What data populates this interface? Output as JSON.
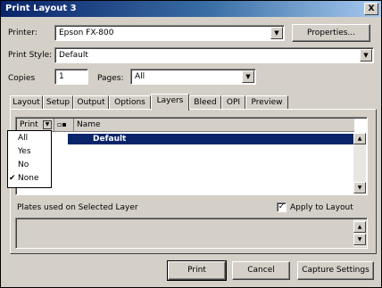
{
  "window": {
    "title": "Print Layout 3",
    "close_label": "X"
  },
  "printer": {
    "label": "Printer:",
    "value": "Epson FX-800",
    "properties_label": "Properties..."
  },
  "print_style": {
    "label": "Print Style:",
    "value": "Default"
  },
  "copies": {
    "label": "Copies",
    "value": "1"
  },
  "pages": {
    "label": "Pages:",
    "value": "All"
  },
  "tabs": [
    "Layout",
    "Setup",
    "Output",
    "Options",
    "Layers",
    "Bleed",
    "OPI",
    "Preview"
  ],
  "active_tab": "Layers",
  "layers_table": {
    "columns": [
      "Print",
      "Name"
    ],
    "rows": [
      {
        "name": "Default"
      }
    ]
  },
  "print_menu": {
    "items": [
      "All",
      "Yes",
      "No",
      "None"
    ],
    "checked": "None"
  },
  "plates_label": "Plates used on Selected Layer",
  "apply_to_layout": {
    "label": "Apply to Layout",
    "checked": true
  },
  "footer": {
    "print_label": "Print",
    "cancel_label": "Cancel",
    "capture_label": "Capture Settings"
  }
}
